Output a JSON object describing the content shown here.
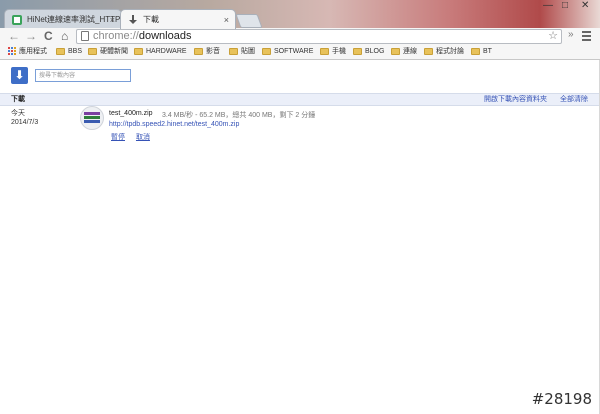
{
  "tabs": [
    {
      "title": "HiNet連線速率測試_HTTP",
      "close": "×",
      "state": "inactive"
    },
    {
      "title": "下載",
      "close": "×",
      "state": "active"
    }
  ],
  "window_controls": {
    "minimize": "—",
    "maximize": "□",
    "close": "✕"
  },
  "toolbar": {
    "back": "←",
    "forward": "→",
    "reload": "C",
    "home": "⌂",
    "url_scheme": "chrome://",
    "url_host": "downloads",
    "star": "☆",
    "extensions": "»",
    "menu": "menu"
  },
  "bookmarks": [
    {
      "label": "應用程式",
      "icon": "apps-icon"
    },
    {
      "label": "BBS",
      "icon": "folder-icon"
    },
    {
      "label": "硬體新聞",
      "icon": "folder-icon"
    },
    {
      "label": "HARDWARE",
      "icon": "folder-icon"
    },
    {
      "label": "影音",
      "icon": "folder-icon"
    },
    {
      "label": "貼圖",
      "icon": "folder-icon"
    },
    {
      "label": "SOFTWARE",
      "icon": "folder-icon"
    },
    {
      "label": "手機",
      "icon": "folder-icon"
    },
    {
      "label": "BLOG",
      "icon": "folder-icon"
    },
    {
      "label": "連線",
      "icon": "folder-icon"
    },
    {
      "label": "程式討論",
      "icon": "folder-icon"
    },
    {
      "label": "BT",
      "icon": "folder-icon"
    }
  ],
  "downloads": {
    "search_placeholder": "搜尋下載內容",
    "section_title": "下載",
    "open_folder_link": "開啟下載內容資料夾",
    "clear_all_link": "全部清除",
    "item": {
      "date_label": "今天",
      "date": "2014/7/3",
      "file_name": "test_400m.zip",
      "status": "3.4 MB/秒 - 65.2 MB，總共 400 MB，剩下 2 分鐘",
      "url": "http://tpdb.speed2.hinet.net/test_400m.zip",
      "pause": "暫停",
      "cancel": "取消"
    }
  },
  "watermark": "#28198",
  "colors": {
    "accent": "#3e6ec7",
    "link": "#3653b6",
    "folder": "#e8c25a"
  }
}
